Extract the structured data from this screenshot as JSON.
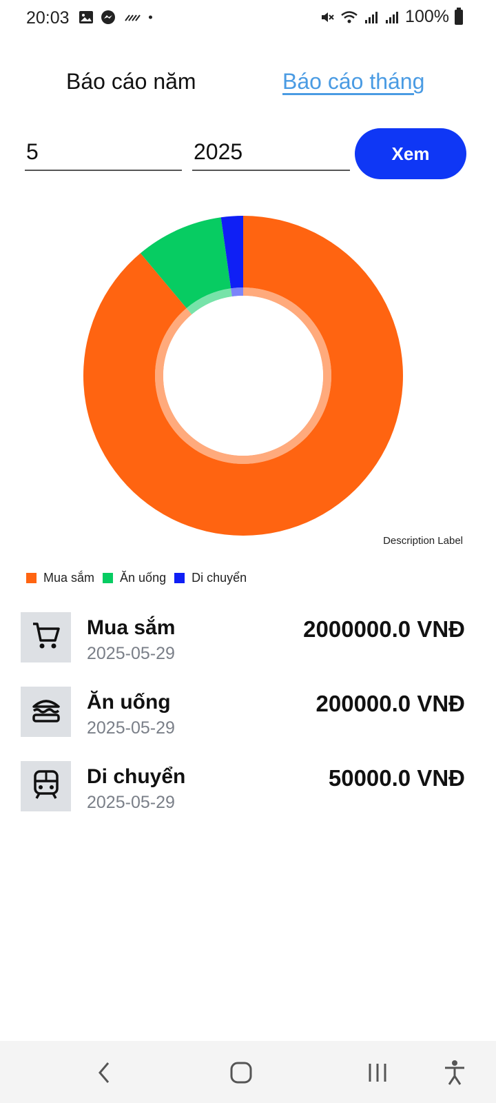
{
  "status_bar": {
    "time": "20:03",
    "battery": "100%",
    "icons": [
      "image-icon",
      "messenger-icon",
      "voicemail-icon",
      "dot-icon",
      "mute-icon",
      "wifi-icon",
      "signal-icon",
      "signal-icon",
      "battery-icon"
    ]
  },
  "tabs": {
    "year_label": "Báo cáo năm",
    "month_label": "Báo cáo tháng"
  },
  "form": {
    "month_value": "5",
    "year_value": "2025",
    "view_button": "Xem"
  },
  "chart_data": {
    "type": "pie",
    "style": "donut",
    "description_label": "Description Label",
    "legend_position": "bottom-left",
    "slices": [
      {
        "label": "Mua sắm",
        "value": 2000000.0,
        "color": "#ff6411"
      },
      {
        "label": "Ăn uống",
        "value": 200000.0,
        "color": "#07cc62"
      },
      {
        "label": "Di chuyển",
        "value": 50000.0,
        "color": "#0f1ff5"
      }
    ]
  },
  "items": [
    {
      "name": "Mua sắm",
      "date": "2025-05-29",
      "amount": "2000000.0 VNĐ",
      "icon": "cart-icon"
    },
    {
      "name": "Ăn uống",
      "date": "2025-05-29",
      "amount": "200000.0 VNĐ",
      "icon": "burger-icon"
    },
    {
      "name": "Di chuyển",
      "date": "2025-05-29",
      "amount": "50000.0 VNĐ",
      "icon": "train-icon"
    }
  ],
  "navbar": {
    "icons": [
      "back-icon",
      "home-icon",
      "recents-icon",
      "accessibility-icon"
    ]
  }
}
